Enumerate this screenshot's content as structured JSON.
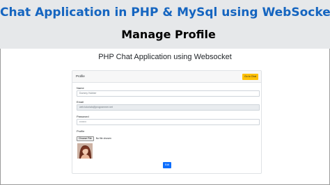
{
  "banner": {
    "title": "Chat Application in PHP & MySql using WebSocket",
    "subtitle": "Manage Profile"
  },
  "app": {
    "heading": "PHP Chat Application using Websocket"
  },
  "profile_card": {
    "title": "Profile",
    "go_to_chat_label": "Go to Chat",
    "fields": {
      "name": {
        "label": "Name",
        "value": "Dummy Hubber"
      },
      "email": {
        "label": "Email",
        "value": "web.tutorials@programmer.net"
      },
      "password": {
        "label": "Password",
        "value": "••••••••"
      },
      "profile": {
        "label": "Profile",
        "choose_file_label": "Choose File",
        "file_status": "No file chosen"
      }
    },
    "edit_label": "Edit"
  },
  "colors": {
    "banner_title": "#1565c0",
    "banner_bg": "#e6e8ea",
    "go_to_chat_button": "#ffc107",
    "edit_button": "#0d6efd"
  },
  "icons": {
    "avatar": "profile-photo"
  }
}
